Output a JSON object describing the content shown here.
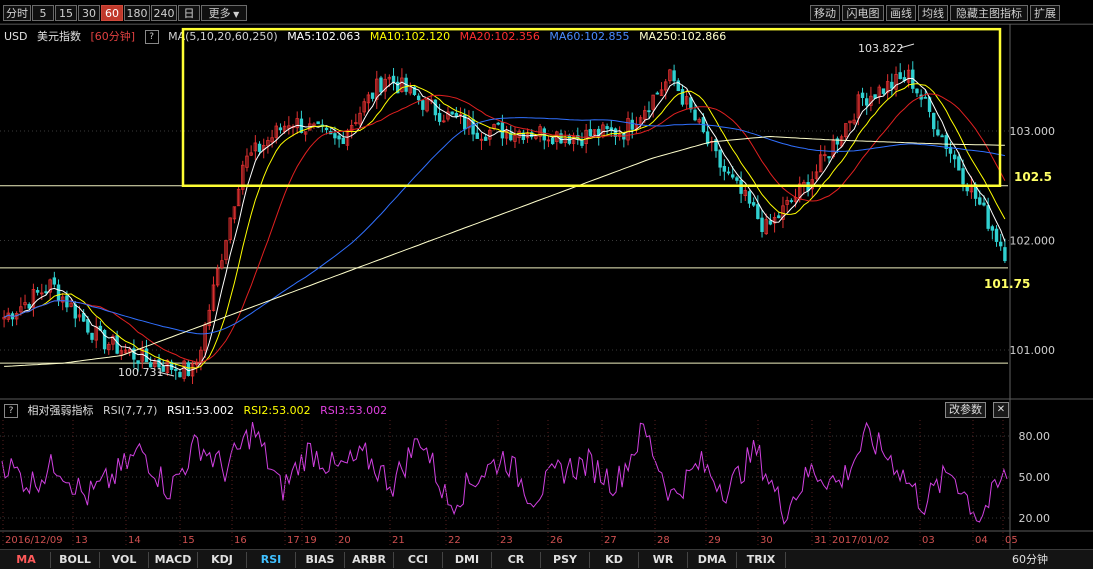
{
  "toolbar": {
    "periods": [
      "分时",
      "5",
      "15",
      "30",
      "60",
      "180",
      "240",
      "日",
      "更多"
    ],
    "active_period": "60",
    "right_buttons": [
      "移动",
      "闪电图",
      "画线",
      "均线",
      "隐藏主图指标",
      "扩展"
    ]
  },
  "main_info": {
    "symbol": "USD",
    "name": "美元指数",
    "period_tag": "[60分钟]",
    "ma_params": "MA(5,10,20,60,250)",
    "ma5": "MA5:102.063",
    "ma10": "MA10:102.120",
    "ma20": "MA20:102.356",
    "ma60": "MA60:102.855",
    "ma250": "MA250:102.866"
  },
  "colors": {
    "up": "#e03030",
    "down": "#30d0d0",
    "ma5": "#ffffff",
    "ma10": "#ffff00",
    "ma20": "#e02020",
    "ma60": "#3070ff",
    "ma250": "#ffffcc",
    "rsi": "#d040e0",
    "box": "#ffff33",
    "axis_text": "#d0d0d0",
    "date_text": "#d05050"
  },
  "annotations": {
    "high_label": "103.822",
    "low_label": "100.731",
    "level_upper": "102.5",
    "level_lower": "101.75"
  },
  "rsi_info": {
    "name": "相对强弱指标",
    "params": "RSI(7,7,7)",
    "rsi1": "RSI1:53.002",
    "rsi2": "RSI2:53.002",
    "rsi3": "RSI3:53.002",
    "edit_button": "改参数",
    "close_button": "✕"
  },
  "bottom_tabs": [
    "MA",
    "BOLL",
    "VOL",
    "MACD",
    "KDJ",
    "RSI",
    "BIAS",
    "ARBR",
    "CCI",
    "DMI",
    "CR",
    "PSY",
    "KD",
    "WR",
    "DMA",
    "TRIX"
  ],
  "period_label": "60分钟",
  "chart_data": [
    {
      "type": "candlestick",
      "title": "USD 美元指数 60分钟",
      "y_ticks": [
        "103.000",
        "102.000",
        "101.000"
      ],
      "ylim": [
        100.6,
        104.0
      ],
      "x_ticks": [
        "2016/12/09",
        "13",
        "14",
        "15",
        "16",
        "17",
        "19",
        "20",
        "21",
        "22",
        "23",
        "26",
        "27",
        "28",
        "29",
        "30",
        "31",
        "2017/01/02",
        "03",
        "04",
        "05"
      ],
      "horizontal_levels": [
        102.5,
        101.75,
        100.88
      ],
      "box": {
        "y_top": 103.93,
        "y_bottom": 102.5,
        "x_start_label": "15",
        "x_end_label": "05"
      },
      "series": [
        {
          "name": "MA250",
          "values": [
            100.85,
            100.88,
            100.95,
            101.15,
            101.35,
            101.55,
            101.75,
            101.95,
            102.15,
            102.35,
            102.55,
            102.75,
            102.9,
            102.95,
            102.92,
            102.9,
            102.88,
            102.87
          ]
        },
        {
          "name": "price",
          "values": [
            101.3,
            101.6,
            101.1,
            100.9,
            100.8,
            102.7,
            103.1,
            102.9,
            103.5,
            103.2,
            103.0,
            103.0,
            102.95,
            103.0,
            103.5,
            102.7,
            102.1,
            102.6,
            103.3,
            103.5,
            102.7,
            101.9
          ]
        },
        {
          "name": "RSI1",
          "values": [
            62,
            45,
            60,
            35,
            50,
            70,
            40,
            75,
            55,
            85,
            40,
            70,
            55,
            65,
            45,
            80,
            30,
            50,
            65,
            35,
            55,
            60,
            45,
            85,
            35,
            60,
            40,
            70,
            25,
            55,
            45,
            80,
            60,
            30,
            55,
            20,
            53
          ]
        }
      ]
    },
    {
      "type": "line",
      "title": "相对强弱指标 RSI(7,7,7)",
      "y_ticks": [
        "80.00",
        "50.00",
        "20.00"
      ],
      "ylim": [
        10,
        95
      ]
    }
  ]
}
